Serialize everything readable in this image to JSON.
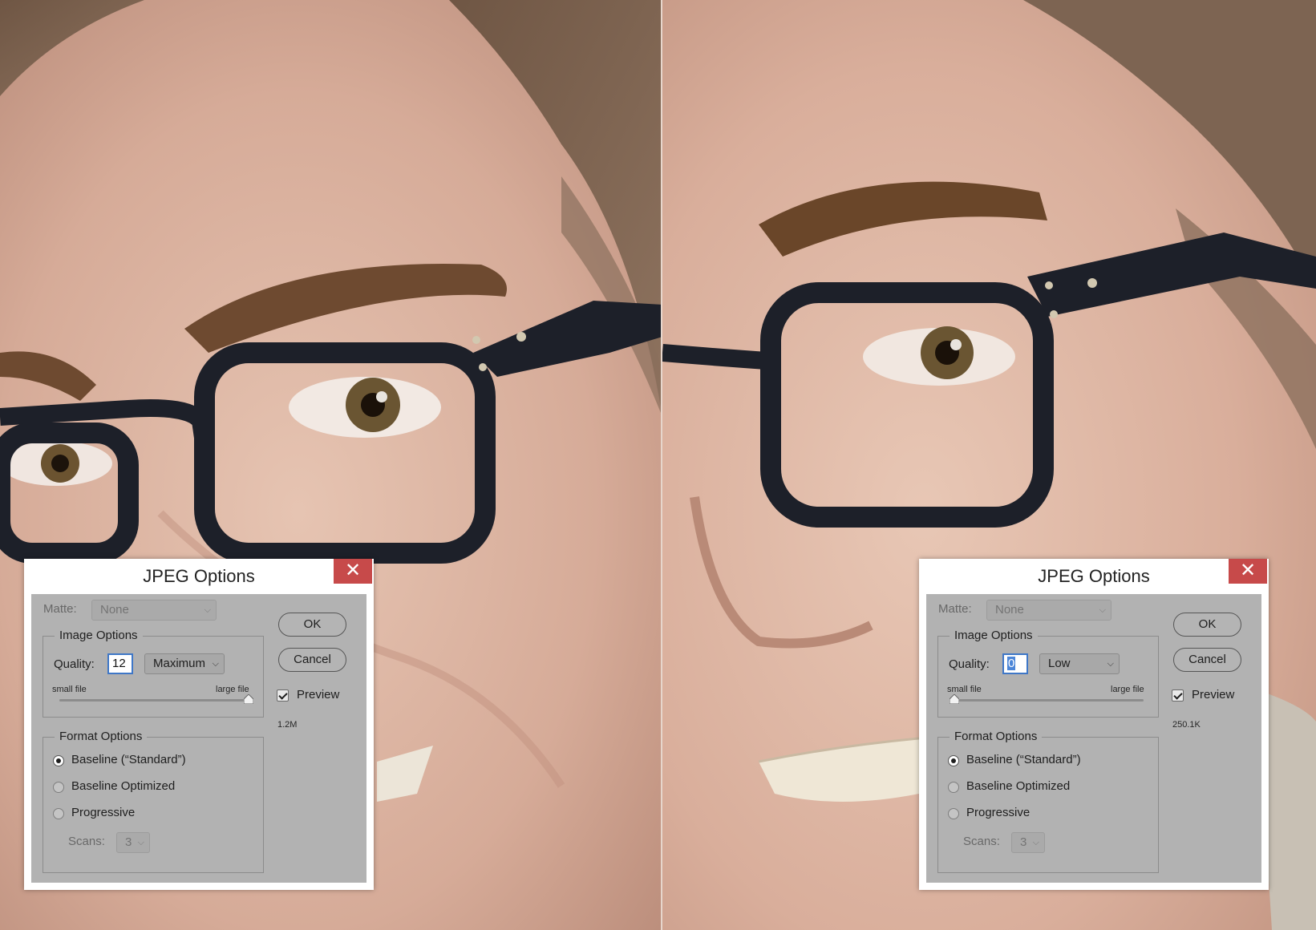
{
  "dialogs": [
    {
      "title": "JPEG Options",
      "matte_label": "Matte:",
      "matte_value": "None",
      "image_options_title": "Image Options",
      "quality_label": "Quality:",
      "quality_value": "12",
      "quality_preset": "Maximum",
      "small_file_label": "small file",
      "large_file_label": "large file",
      "slider_position": 1.0,
      "format_options_title": "Format Options",
      "radio_baseline": "Baseline (“Standard”)",
      "radio_optimized": "Baseline Optimized",
      "radio_progressive": "Progressive",
      "selected_format": "baseline",
      "scans_label": "Scans:",
      "scans_value": "3",
      "ok_label": "OK",
      "cancel_label": "Cancel",
      "preview_label": "Preview",
      "preview_checked": true,
      "file_size": "1.2M"
    },
    {
      "title": "JPEG Options",
      "matte_label": "Matte:",
      "matte_value": "None",
      "image_options_title": "Image Options",
      "quality_label": "Quality:",
      "quality_value": "0",
      "quality_preset": "Low",
      "small_file_label": "small file",
      "large_file_label": "large file",
      "slider_position": 0.0,
      "format_options_title": "Format Options",
      "radio_baseline": "Baseline (“Standard”)",
      "radio_optimized": "Baseline Optimized",
      "radio_progressive": "Progressive",
      "selected_format": "baseline",
      "scans_label": "Scans:",
      "scans_value": "3",
      "ok_label": "OK",
      "cancel_label": "Cancel",
      "preview_label": "Preview",
      "preview_checked": true,
      "file_size": "250.1K"
    }
  ],
  "colors": {
    "close_button": "#c74a4a",
    "dialog_panel": "#b2b2b2",
    "quality_focus": "#3f77c7"
  },
  "icons": {
    "close": "close-icon",
    "dropdown": "chevron-down-icon",
    "slider_thumb": "slider-thumb-icon",
    "checkbox": "checkbox-icon"
  }
}
